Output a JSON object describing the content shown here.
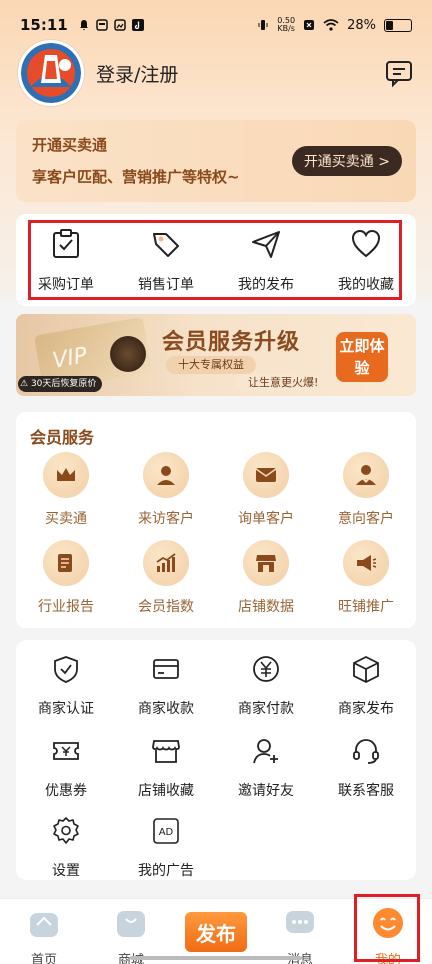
{
  "status_bar": {
    "time": "15:11",
    "net_speed_value": "0.50",
    "net_speed_unit": "KB/s",
    "battery": "28%",
    "battery_level": 0.28
  },
  "header": {
    "login_label": "登录/注册",
    "message_icon": "message-icon"
  },
  "vip_card": {
    "title": "开通买卖通",
    "subtitle": "享客户匹配、营销推广等特权~",
    "button_label": "开通买卖通 >"
  },
  "orders": [
    {
      "label": "采购订单",
      "icon": "clipboard-check-icon"
    },
    {
      "label": "销售订单",
      "icon": "tag-icon"
    },
    {
      "label": "我的发布",
      "icon": "paper-plane-icon"
    },
    {
      "label": "我的收藏",
      "icon": "heart-icon"
    }
  ],
  "promo": {
    "title": "会员服务升级",
    "sub1": "十大专属权益",
    "sub2": "让生意更火爆!",
    "cta": "立即体验",
    "badge": "30天后恢复原价",
    "card_text": "VIP"
  },
  "member_services": {
    "heading": "会员服务",
    "items": [
      {
        "label": "买卖通",
        "icon": "crown-icon"
      },
      {
        "label": "来访客户",
        "icon": "person-icon"
      },
      {
        "label": "询单客户",
        "icon": "envelope-icon"
      },
      {
        "label": "意向客户",
        "icon": "person-heart-icon"
      },
      {
        "label": "行业报告",
        "icon": "report-icon"
      },
      {
        "label": "会员指数",
        "icon": "trend-chart-icon"
      },
      {
        "label": "店铺数据",
        "icon": "store-icon"
      },
      {
        "label": "旺铺推广",
        "icon": "megaphone-icon"
      }
    ]
  },
  "tools": [
    {
      "label": "商家认证",
      "icon": "shield-check-icon"
    },
    {
      "label": "商家收款",
      "icon": "card-icon"
    },
    {
      "label": "商家付款",
      "icon": "yuan-coin-icon"
    },
    {
      "label": "商家发布",
      "icon": "box-icon"
    },
    {
      "label": "优惠券",
      "icon": "coupon-icon"
    },
    {
      "label": "店铺收藏",
      "icon": "shop-icon"
    },
    {
      "label": "邀请好友",
      "icon": "add-user-icon"
    },
    {
      "label": "联系客服",
      "icon": "headset-icon"
    },
    {
      "label": "设置",
      "icon": "gear-icon"
    },
    {
      "label": "我的广告",
      "icon": "ad-icon"
    }
  ],
  "bottom_nav": [
    {
      "label": "首页",
      "icon": "home-icon"
    },
    {
      "label": "商城",
      "icon": "mall-icon"
    },
    {
      "label": "发布",
      "icon": "publish-icon"
    },
    {
      "label": "消息",
      "icon": "chat-icon"
    },
    {
      "label": "我的",
      "icon": "smile-icon"
    }
  ],
  "colors": {
    "accent": "#f06b15",
    "brand_brown": "#8a4a1c",
    "highlight_box": "#e01e25"
  }
}
